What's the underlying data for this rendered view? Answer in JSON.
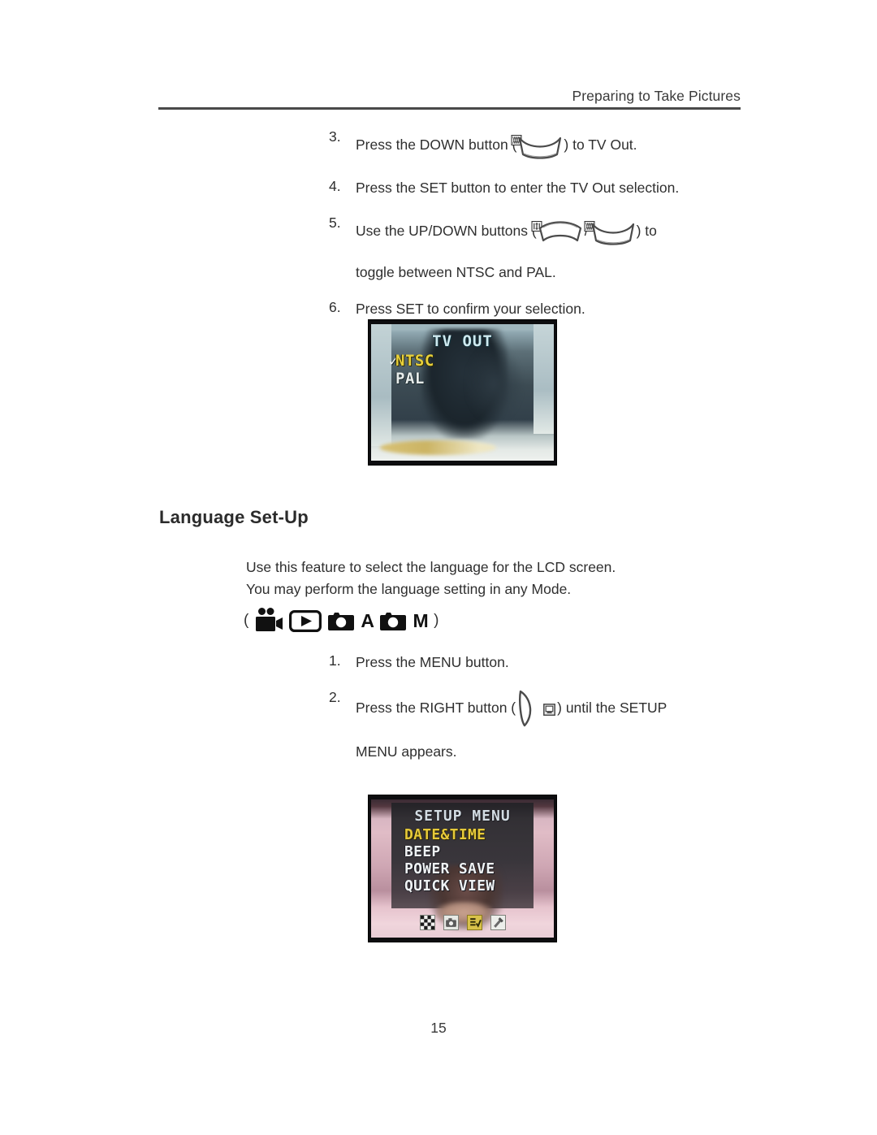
{
  "header": {
    "title": "Preparing to Take Pictures"
  },
  "steps_tvout": [
    {
      "num": "3.",
      "pre": "Press the DOWN button (",
      "glyph": "down-button-arc",
      "post": ") to TV Out."
    },
    {
      "num": "4.",
      "pre": "Press the SET button to enter the TV Out selection.",
      "glyph": "",
      "post": ""
    },
    {
      "num": "5.",
      "pre": "Use the UP/DOWN buttons (",
      "glyph": "up-down-button-arcs",
      "sep": "/",
      "post": ") to",
      "line2": "toggle between NTSC and PAL."
    },
    {
      "num": "6.",
      "pre": "Press SET to confirm your selection.",
      "glyph": "",
      "post": ""
    }
  ],
  "lcd_tvout": {
    "title": "TV OUT",
    "check": "✓",
    "items": [
      {
        "label": "NTSC",
        "selected": true
      },
      {
        "label": "PAL",
        "selected": false
      }
    ]
  },
  "section": {
    "heading": "Language Set-Up",
    "paragraph_line1": "Use this feature to select the language for the LCD screen.",
    "paragraph_line2": "You may perform the language setting in any Mode.",
    "mode_open_paren": "(",
    "mode_close_paren": ")",
    "modes": [
      {
        "icon": "video-camera-icon",
        "letter": ""
      },
      {
        "icon": "playback-icon",
        "letter": ""
      },
      {
        "icon": "camera-icon",
        "letter": "A"
      },
      {
        "icon": "camera-icon",
        "letter": "M"
      }
    ]
  },
  "steps_language": [
    {
      "num": "1.",
      "pre": "Press the MENU button.",
      "glyph": "",
      "post": ""
    },
    {
      "num": "2.",
      "pre": "Press the RIGHT button (",
      "glyph": "right-button-lens",
      "post": ") until the SETUP",
      "line2": "MENU appears."
    }
  ],
  "lcd_setup": {
    "title": "SETUP MENU",
    "items": [
      {
        "label": "DATE&TIME",
        "selected": true
      },
      {
        "label": "BEEP",
        "selected": false
      },
      {
        "label": "POWER SAVE",
        "selected": false
      },
      {
        "label": "QUICK VIEW",
        "selected": false
      }
    ],
    "tabs": [
      {
        "icon": "checkerboard-tab-icon",
        "selected": false
      },
      {
        "icon": "camera-tab-icon",
        "selected": false
      },
      {
        "icon": "setup-list-tab-icon",
        "selected": true
      },
      {
        "icon": "tools-tab-icon",
        "selected": false
      }
    ]
  },
  "footer": {
    "page_number": "15"
  },
  "colors": {
    "rule": "#4a4a4a",
    "text": "#2f2f2f",
    "lcd_highlight": "#e6c93a",
    "lcd_text": "#eef1f3"
  }
}
